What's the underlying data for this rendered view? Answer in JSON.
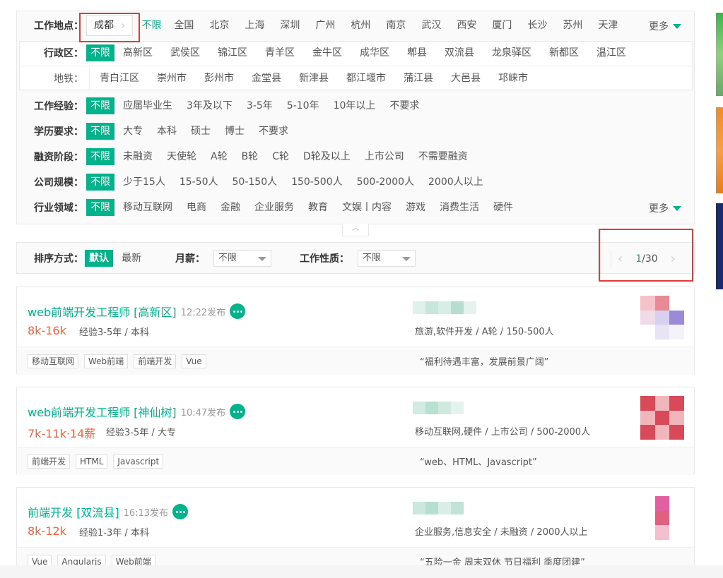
{
  "location": {
    "label": "工作地点：",
    "city": "成都",
    "all_label": "不限",
    "cities": [
      "全国",
      "北京",
      "上海",
      "深圳",
      "广州",
      "杭州",
      "南京",
      "武汉",
      "西安",
      "厦门",
      "长沙",
      "苏州",
      "天津"
    ],
    "more": "更多"
  },
  "district": {
    "label": "行政区：",
    "all_label": "不限",
    "items": [
      "高新区",
      "武侯区",
      "锦江区",
      "青羊区",
      "金牛区",
      "成华区",
      "郫县",
      "双流县",
      "龙泉驿区",
      "新都区",
      "温江区",
      "青白江区",
      "崇州市",
      "彭州市",
      "金堂县",
      "新津县",
      "都江堰市",
      "蒲江县",
      "大邑县",
      "邛崃市"
    ],
    "subway_label": "地铁："
  },
  "filters": [
    {
      "label": "工作经验：",
      "all": "不限",
      "options": [
        "应届毕业生",
        "3年及以下",
        "3-5年",
        "5-10年",
        "10年以上",
        "不要求"
      ]
    },
    {
      "label": "学历要求：",
      "all": "不限",
      "options": [
        "大专",
        "本科",
        "硕士",
        "博士",
        "不要求"
      ]
    },
    {
      "label": "融资阶段：",
      "all": "不限",
      "options": [
        "未融资",
        "天使轮",
        "A轮",
        "B轮",
        "C轮",
        "D轮及以上",
        "上市公司",
        "不需要融资"
      ]
    },
    {
      "label": "公司规模：",
      "all": "不限",
      "options": [
        "少于15人",
        "15-50人",
        "50-150人",
        "150-500人",
        "500-2000人",
        "2000人以上"
      ]
    },
    {
      "label": "行业领域：",
      "all": "不限",
      "options": [
        "移动互联网",
        "电商",
        "金融",
        "企业服务",
        "教育",
        "文娱丨内容",
        "游戏",
        "消费生活",
        "硬件"
      ]
    }
  ],
  "industry_more": "更多",
  "sort": {
    "label": "排序方式：",
    "default": "默认",
    "newest": "最新",
    "salary_label": "月薪：",
    "salary_value": "不限",
    "nature_label": "工作性质：",
    "nature_value": "不限",
    "page_current": "1",
    "page_sep": " / ",
    "page_total": "30"
  },
  "jobs": [
    {
      "title": "web前端开发工程师 [高新区]",
      "time": "12:22发布",
      "salary": "8k-16k",
      "requirements": "经验3-5年 / 本科",
      "company_info": "旅游,软件开发 / A轮 / 150-500人",
      "tags": [
        "移动互联网",
        "Web前端",
        "前端开发",
        "Vue"
      ],
      "slogan": "“福利待遇丰富，发展前景广阔”"
    },
    {
      "title": "web前端开发工程师 [神仙树]",
      "time": "10:47发布",
      "salary": "7k-11k·14薪",
      "requirements": "经验3-5年 / 大专",
      "company_info": "移动互联网,硬件 / 上市公司 / 500-2000人",
      "tags": [
        "前端开发",
        "HTML",
        "Javascript"
      ],
      "slogan": "“web、HTML、Javascript”"
    },
    {
      "title": "前端开发 [双流县]",
      "time": "16:13发布",
      "salary": "8k-12k",
      "requirements": "经验1-3年 / 本科",
      "company_info": "企业服务,信息安全 / 未融资 / 2000人以上",
      "tags": [
        "Vue",
        "Angularjs",
        "Web前端"
      ],
      "slogan": "“五险一金 周末双休 节日福利 季度团建”"
    }
  ],
  "colors": {
    "accent": "#00b38a",
    "salary": "#fd5f39",
    "highlight_box": "#e53935"
  }
}
